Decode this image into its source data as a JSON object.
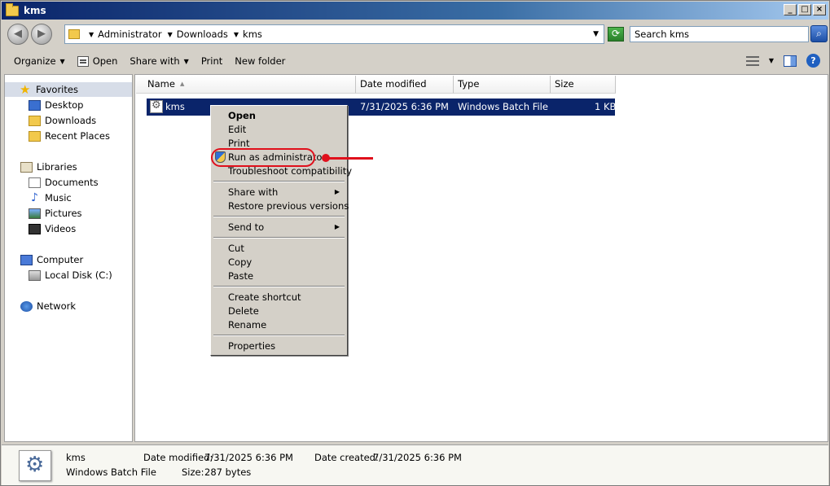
{
  "window": {
    "title": "kms"
  },
  "address": {
    "crumbs": [
      "Administrator",
      "Downloads",
      "kms"
    ],
    "search_placeholder": "Search kms"
  },
  "toolbar": {
    "organize": "Organize",
    "open": "Open",
    "share_with": "Share with",
    "print": "Print",
    "new_folder": "New folder"
  },
  "nav": {
    "favorites": "Favorites",
    "desktop": "Desktop",
    "downloads": "Downloads",
    "recent_places": "Recent Places",
    "libraries": "Libraries",
    "documents": "Documents",
    "music": "Music",
    "pictures": "Pictures",
    "videos": "Videos",
    "computer": "Computer",
    "local_disk": "Local Disk (C:)",
    "network": "Network"
  },
  "columns": {
    "name": "Name",
    "date_modified": "Date modified",
    "type": "Type",
    "size": "Size"
  },
  "file": {
    "name": "kms",
    "date_modified": "7/31/2025 6:36 PM",
    "type": "Windows Batch File",
    "size": "1 KB"
  },
  "context_menu": {
    "open": "Open",
    "edit": "Edit",
    "print": "Print",
    "run_as_admin": "Run as administrator",
    "troubleshoot": "Troubleshoot compatibility",
    "share_with": "Share with",
    "restore_previous": "Restore previous versions",
    "send_to": "Send to",
    "cut": "Cut",
    "copy": "Copy",
    "paste": "Paste",
    "create_shortcut": "Create shortcut",
    "delete": "Delete",
    "rename": "Rename",
    "properties": "Properties"
  },
  "details": {
    "name": "kms",
    "type": "Windows Batch File",
    "date_modified_label": "Date modified:",
    "date_modified": "7/31/2025 6:36 PM",
    "size_label": "Size:",
    "size": "287 bytes",
    "date_created_label": "Date created:",
    "date_created": "7/31/2025 6:36 PM"
  },
  "colors": {
    "selection": "#0a246a",
    "annotation": "#e0101c",
    "title_gradient_start": "#0a246a"
  }
}
